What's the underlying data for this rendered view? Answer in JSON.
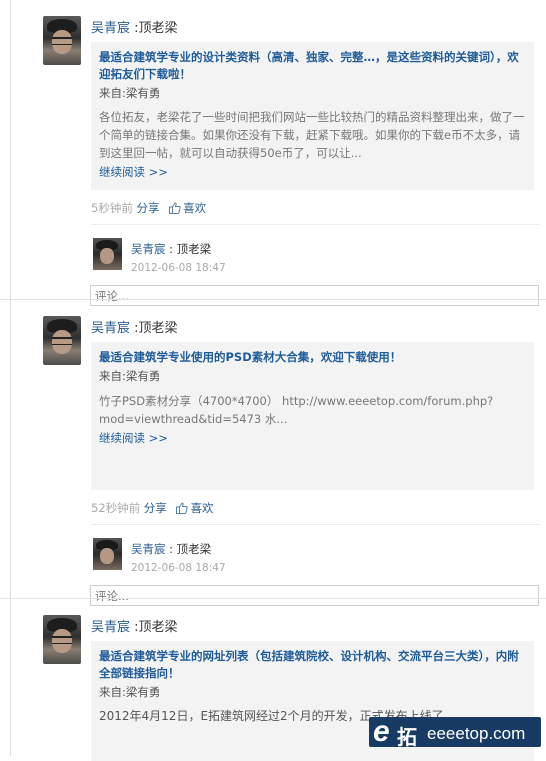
{
  "posts": [
    {
      "header_author": "吴青宸",
      "header_rest": " :顶老梁",
      "card": {
        "title": "最适合建筑学专业的设计类资料（高清、独家、完整…，是这些资料的关键词），欢迎拓友们下载啦！",
        "from_label": "来自:",
        "from_name": "梁有勇",
        "body": "各位拓友，老梁花了一些时间把我们网站一些比较热门的精品资料整理出来，做了一个简单的链接合集。如果你还没有下载，赶紧下载哦。如果你的下载e币不太多，请到这里回一帖，就可以自动获得50e币了，可以让...",
        "more": "继续阅读 >>"
      },
      "actions": {
        "time": "5秒钟前",
        "share": "分享",
        "like": "喜欢"
      },
      "reply": {
        "author": "吴青宸",
        "text": ": 顶老梁",
        "time": "2012-06-08 18:47"
      },
      "comment_placeholder": "评论..."
    },
    {
      "header_author": "吴青宸",
      "header_rest": " :顶老梁",
      "card": {
        "title": "最适合建筑学专业使用的PSD素材大合集，欢迎下载使用！",
        "from_label": "来自:",
        "from_name": "梁有勇",
        "body": "竹子PSD素材分享（4700*4700） http://www.eeeetop.com/forum.php?mod=viewthread&tid=5473 水...",
        "more": "继续阅读 >>"
      },
      "actions": {
        "time": "52秒钟前",
        "share": "分享",
        "like": "喜欢"
      },
      "reply": {
        "author": "吴青宸",
        "text": ": 顶老梁",
        "time": "2012-06-08 18:47"
      },
      "comment_placeholder": "评论..."
    },
    {
      "header_author": "吴青宸",
      "header_rest": " :顶老梁",
      "card": {
        "title": "最适合建筑学专业的网址列表（包括建筑院校、设计机构、交流平台三大类），内附全部链接指向！",
        "from_label": "来自:",
        "from_name": "梁有勇",
        "body": "2012年4月12日，E拓建筑网经过2个月的开发，正式发布上线了...",
        "more": ""
      }
    }
  ],
  "watermark": {
    "logo": "e",
    "cn": "拓",
    "url": "eeeetop.com"
  },
  "colors": {
    "link": "#1f5b99",
    "card_bg": "#f3f3f3",
    "muted": "#aaaaaa"
  }
}
